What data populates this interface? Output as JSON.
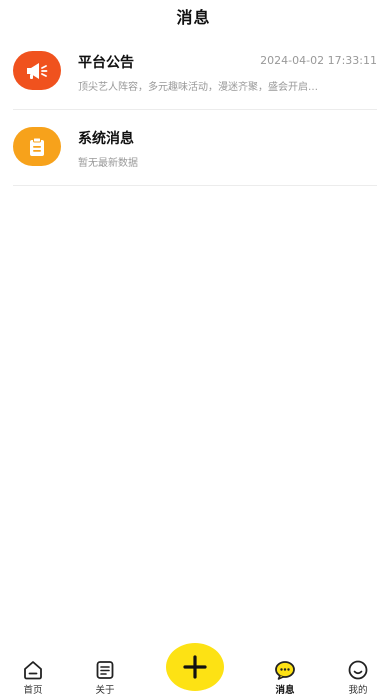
{
  "header": {
    "title": "消息"
  },
  "messages": [
    {
      "title": "平台公告",
      "time": "2024-04-02 17:33:11",
      "preview": "顶尖艺人阵容，多元趣味活动，漫迷齐聚，盛会开启…",
      "icon": "megaphone-icon",
      "icon_color": "#f0521e"
    },
    {
      "title": "系统消息",
      "time": "",
      "preview": "暂无最新数据",
      "icon": "clipboard-icon",
      "icon_color": "#f7a21b"
    }
  ],
  "tabbar": {
    "home": "首页",
    "about": "关于",
    "messages": "消息",
    "mine": "我的",
    "active": "messages",
    "fab_icon": "plus-icon",
    "fab_color": "#fde214"
  }
}
